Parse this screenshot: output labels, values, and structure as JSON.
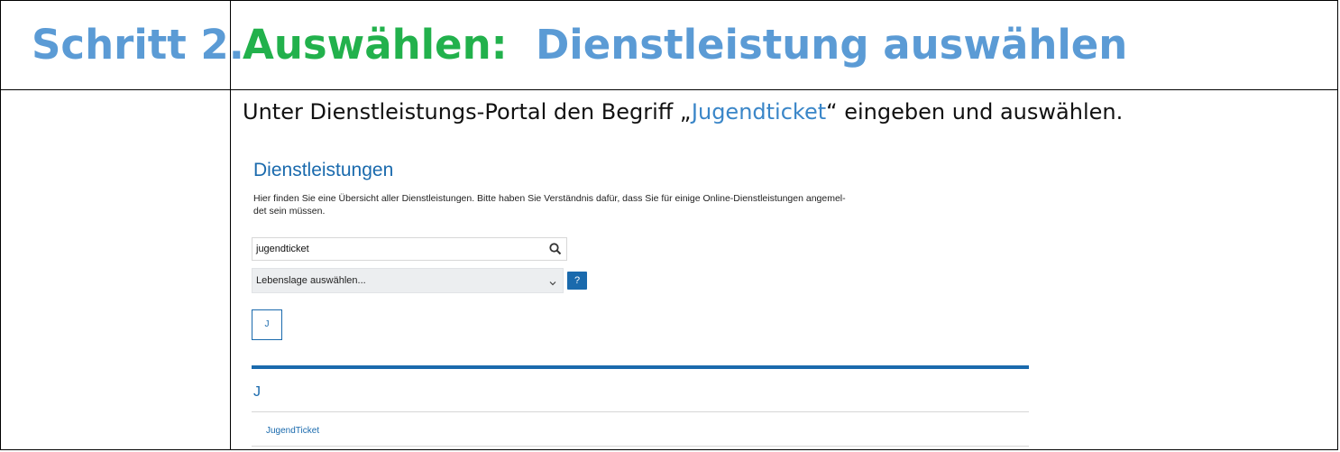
{
  "table": {
    "step_label": "Schritt 2.",
    "title_green": "Auswählen:",
    "title_blue": "Dienstleistung auswählen",
    "instruction_before": "Unter Dienstleistungs-Portal den Begriff „",
    "instruction_highlight": "Jugendticket",
    "instruction_after": "“ eingeben und auswählen."
  },
  "portal": {
    "heading": "Dienstleistungen",
    "description_line1": "Hier finden Sie eine Übersicht aller Dienstleistungen. Bitte haben Sie Verständnis dafür, dass Sie für einige Online-Dienstleistungen angemel-",
    "description_line2": "det sein müssen.",
    "search_value": "jugendticket",
    "search_icon": "search-icon",
    "select_value": "Lebenslage auswählen...",
    "help_label": "?",
    "letter_filter": "J",
    "section_letter": "J",
    "result_link": "JugendTicket"
  },
  "colors": {
    "step_blue": "#5b9bd5",
    "title_green": "#22b14c",
    "portal_blue": "#1a6aad"
  }
}
